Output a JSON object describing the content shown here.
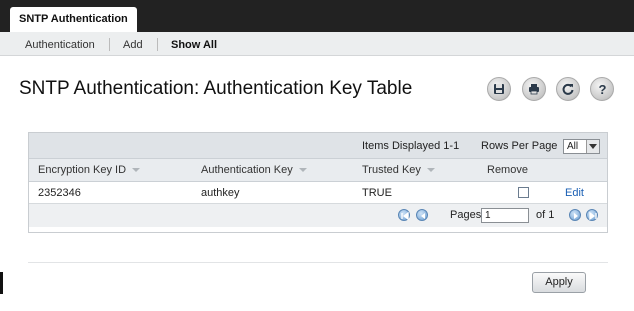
{
  "top_tab": {
    "label": "SNTP Authentication"
  },
  "subnav": {
    "items": [
      "Authentication",
      "Add",
      "Show All"
    ]
  },
  "page": {
    "title": "SNTP Authentication: Authentication Key Table"
  },
  "toolbar": {
    "icons": [
      "save-icon",
      "print-icon",
      "refresh-icon",
      "help-icon"
    ]
  },
  "table": {
    "items_displayed": "Items Displayed 1-1",
    "rows_per_page_label": "Rows Per Page",
    "rows_per_page_value": "All",
    "columns": [
      "Encryption Key ID",
      "Authentication Key",
      "Trusted Key",
      "Remove"
    ],
    "rows": [
      {
        "key_id": "2352346",
        "auth_key": "authkey",
        "trusted": "TRUE",
        "remove_checked": false,
        "action": "Edit"
      }
    ],
    "pager": {
      "pages_label": "Pages",
      "page_value": "1",
      "of_label": "of 1"
    }
  },
  "footer": {
    "apply_label": "Apply"
  }
}
